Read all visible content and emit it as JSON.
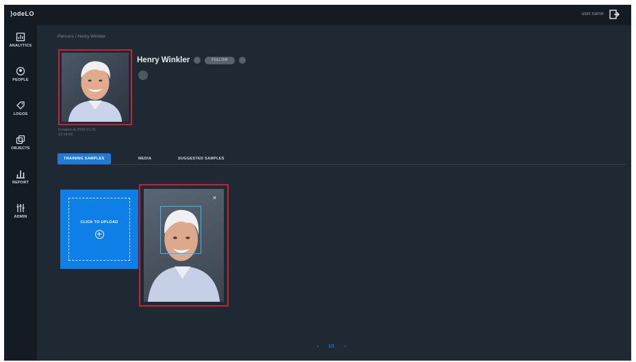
{
  "app": {
    "logo_text": "⟩odeLO"
  },
  "header": {
    "user_label": "user.name",
    "logout_icon": "logout-icon"
  },
  "sidebar": {
    "items": [
      {
        "label": "ANALYTICS",
        "icon": "analytics-icon"
      },
      {
        "label": "PEOPLE",
        "icon": "people-icon"
      },
      {
        "label": "LOGOS",
        "icon": "logos-icon"
      },
      {
        "label": "OBJECTS",
        "icon": "objects-icon"
      },
      {
        "label": "REPORT",
        "icon": "report-icon"
      },
      {
        "label": "ADMIN",
        "icon": "admin-icon"
      }
    ]
  },
  "breadcrumb": "Persons / Henry Winkler",
  "person": {
    "name": "Henry Winkler",
    "follow_label": "FOLLOW",
    "created_line1": "Created at 2020-01-01",
    "created_line2": "12:34:56"
  },
  "tabs": [
    {
      "label": "TRAINING SAMPLES",
      "active": true
    },
    {
      "label": "MEDIA",
      "active": false
    },
    {
      "label": "SUGGESTED SAMPLES",
      "active": false
    }
  ],
  "upload": {
    "label": "CLICK TO UPLOAD"
  },
  "sample": {
    "close_label": "×"
  },
  "pagination": {
    "prev": "‹",
    "current": "1/1",
    "next": "›"
  },
  "colors": {
    "accent": "#1f7ad8",
    "upload_bg": "#0f7fe8",
    "highlight": "#c62336",
    "facebox": "#3fb5f2",
    "background": "#1f2933",
    "sidebar": "#141b22"
  }
}
